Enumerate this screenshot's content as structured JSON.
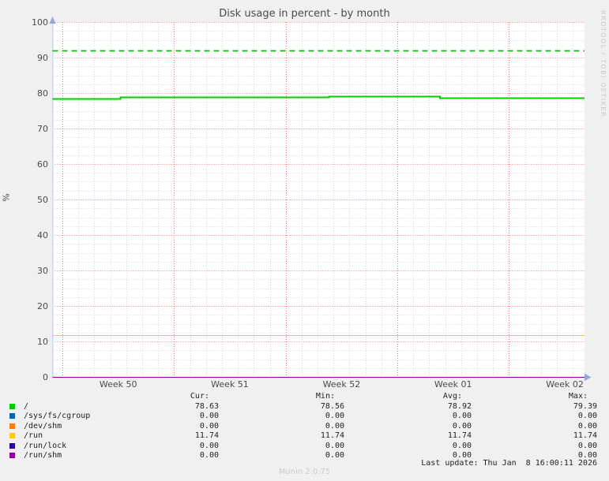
{
  "chart_data": {
    "type": "line",
    "title": "Disk usage in percent - by month",
    "ylabel": "%",
    "ylim": [
      0,
      100
    ],
    "y_ticks": [
      0,
      10,
      20,
      30,
      40,
      50,
      60,
      70,
      80,
      90,
      100
    ],
    "x_tick_labels": [
      "Week 50",
      "Week 51",
      "Week 52",
      "Week 01",
      "Week 02"
    ],
    "grid": {
      "on": true,
      "major_color": "#ee7d7d",
      "minor_color": "#d7d7d7",
      "minor_y_step": 2.5
    },
    "warning_line": {
      "value": 92,
      "color": "#00aa00",
      "style": "dashed"
    },
    "series": [
      {
        "name": "/",
        "color": "#00cc00",
        "points": [
          [
            0,
            78.55
          ],
          [
            0.128,
            78.55
          ],
          [
            0.128,
            78.8
          ],
          [
            0.52,
            78.8
          ],
          [
            0.52,
            79.05
          ],
          [
            0.728,
            79.05
          ],
          [
            0.728,
            78.7
          ],
          [
            1,
            78.7
          ]
        ]
      },
      {
        "name": "/sys/fs/cgroup",
        "color": "#0066b3",
        "points": [
          [
            0,
            0
          ],
          [
            1,
            0
          ]
        ]
      },
      {
        "name": "/dev/shm",
        "color": "#ff8000",
        "points": [
          [
            0,
            0
          ],
          [
            1,
            0
          ]
        ]
      },
      {
        "name": "/run",
        "color": "#ffcc00",
        "points": [
          [
            0,
            11.74
          ],
          [
            1,
            11.74
          ]
        ]
      },
      {
        "name": "/run/lock",
        "color": "#330099",
        "points": [
          [
            0,
            0
          ],
          [
            1,
            0
          ]
        ]
      },
      {
        "name": "/run/shm",
        "color": "#990099",
        "points": [
          [
            0,
            0
          ],
          [
            1,
            0
          ]
        ]
      }
    ],
    "legend_table": {
      "headers": [
        "Cur:",
        "Min:",
        "Avg:",
        "Max:"
      ],
      "rows": [
        {
          "label": "/",
          "color": "#00cc00",
          "values": [
            "78.63",
            "78.56",
            "78.92",
            "79.39"
          ]
        },
        {
          "label": "/sys/fs/cgroup",
          "color": "#0066b3",
          "values": [
            "0.00",
            "0.00",
            "0.00",
            "0.00"
          ]
        },
        {
          "label": "/dev/shm",
          "color": "#ff8000",
          "values": [
            "0.00",
            "0.00",
            "0.00",
            "0.00"
          ]
        },
        {
          "label": "/run",
          "color": "#ffcc00",
          "values": [
            "11.74",
            "11.74",
            "11.74",
            "11.74"
          ]
        },
        {
          "label": "/run/lock",
          "color": "#330099",
          "values": [
            "0.00",
            "0.00",
            "0.00",
            "0.00"
          ]
        },
        {
          "label": "/run/shm",
          "color": "#990099",
          "values": [
            "0.00",
            "0.00",
            "0.00",
            "0.00"
          ]
        }
      ]
    }
  },
  "footer": {
    "last_update": "Last update: Thu Jan  8 16:00:11 2026",
    "version": "Munin 2.0.75"
  },
  "watermark": "RRDTOOL / TOBI OETIKER"
}
